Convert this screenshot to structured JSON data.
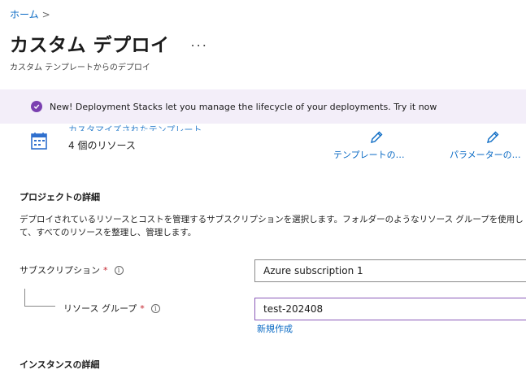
{
  "breadcrumb": {
    "home": "ホーム",
    "separator": ">"
  },
  "header": {
    "title": "カスタム デプロイ",
    "more": "...",
    "subtitle": "カスタム テンプレートからのデプロイ"
  },
  "banner": {
    "text": "New! Deployment Stacks let you manage the lifecycle of your deployments. Try it now"
  },
  "template": {
    "link_text": "カスタマイズされたテンプレート",
    "resource_count": "4 個のリソース",
    "edit_template": "テンプレートの…",
    "edit_parameters": "パラメーターの…"
  },
  "project": {
    "heading": "プロジェクトの詳細",
    "description": "デプロイされているリソースとコストを管理するサブスクリプションを選択します。フォルダーのようなリソース グループを使用して、すべてのリソースを整理し、管理します。",
    "subscription_label": "サブスクリプション",
    "subscription_value": "Azure subscription 1",
    "resource_group_label": "リソース グループ",
    "resource_group_value": "test-202408",
    "create_new": "新規作成",
    "required_mark": "*",
    "info_glyph": "i"
  },
  "instance": {
    "heading": "インスタンスの詳細"
  },
  "colors": {
    "accent": "#0a6ac4",
    "banner_bg": "#f3eef9",
    "banner_icon": "#7a3fb0",
    "required": "#c3202a",
    "focus": "#8a5ab8"
  }
}
